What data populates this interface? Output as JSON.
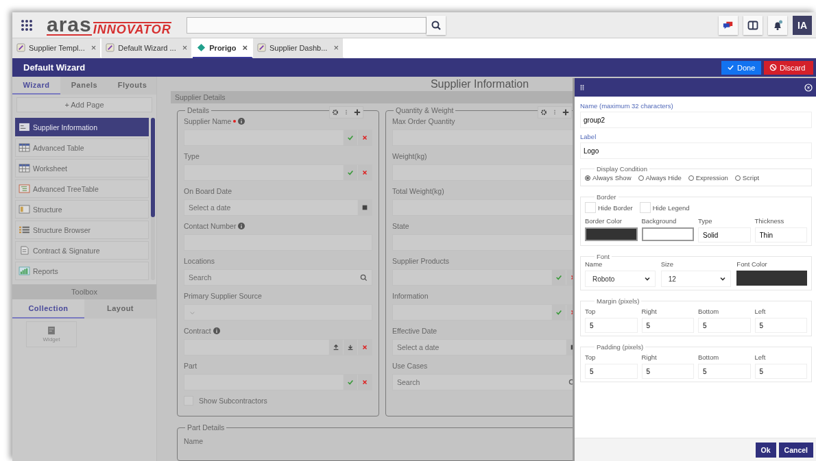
{
  "header": {
    "logo": {
      "word": "aras",
      "product": "INNOVATOR"
    },
    "avatar": "IA"
  },
  "tabs": [
    {
      "label": "Supplier Templ...",
      "kind": "pencil",
      "close": "×",
      "selected": false
    },
    {
      "label": "Default Wizard ...",
      "kind": "pencil",
      "close": "×",
      "selected": false
    },
    {
      "label": "Prorigo",
      "kind": "diamond",
      "close": "×",
      "selected": true
    },
    {
      "label": "Supplier Dashb...",
      "kind": "pencil",
      "close": "×",
      "selected": false
    }
  ],
  "title_bar": {
    "title": "Default Wizard",
    "done": "Done",
    "discard": "Discard"
  },
  "sidebar": {
    "tabs": [
      {
        "label": "Wizard",
        "selected": true
      },
      {
        "label": "Panels",
        "selected": false
      },
      {
        "label": "Flyouts",
        "selected": false
      }
    ],
    "add_page": "+ Add Page",
    "pages": [
      {
        "label": "Supplier Information",
        "kind": "form",
        "selected": true
      },
      {
        "label": "Advanced Table",
        "kind": "table",
        "selected": false
      },
      {
        "label": "Worksheet",
        "kind": "sheet",
        "selected": false
      },
      {
        "label": "Advanced TreeTable",
        "kind": "tree",
        "selected": false
      },
      {
        "label": "Structure",
        "kind": "structure",
        "selected": false
      },
      {
        "label": "Structure Browser",
        "kind": "list",
        "selected": false
      },
      {
        "label": "Contract & Signature",
        "kind": "document",
        "selected": false
      },
      {
        "label": "Reports",
        "kind": "chart",
        "selected": false
      }
    ],
    "toolbox": "Toolbox",
    "toolbox_tabs": [
      {
        "label": "Collection",
        "selected": true
      },
      {
        "label": "Layout",
        "selected": false
      }
    ],
    "widgets": [
      {
        "label": "Widget"
      }
    ]
  },
  "page": {
    "title": "Supplier Information",
    "section": "Supplier Details",
    "groups": [
      {
        "legend": "Details",
        "fields": [
          {
            "label": "Supplier Name",
            "kind": "validate",
            "required": true,
            "info": true
          },
          {
            "label": "Type",
            "kind": "validate",
            "required": false,
            "info": false
          },
          {
            "label": "On Board Date",
            "kind": "date",
            "placeholder": "Select a date",
            "required": false,
            "info": false
          },
          {
            "label": "Contact Number",
            "kind": "text",
            "required": false,
            "info": true
          },
          {
            "label": "Locations",
            "kind": "search",
            "placeholder": "Search",
            "required": false,
            "info": false
          },
          {
            "label": "Primary Supplier Source",
            "kind": "select",
            "required": false,
            "info": false
          },
          {
            "label": "Contract",
            "kind": "upload",
            "required": false,
            "info": true
          },
          {
            "label": "Part",
            "kind": "validate",
            "required": false,
            "info": false
          },
          {
            "label": "Show Subcontractors",
            "kind": "checkbox",
            "checked": false
          }
        ]
      },
      {
        "legend": "Quantity & Weight",
        "fields": [
          {
            "label": "Max Order Quantity",
            "kind": "text",
            "required": false,
            "info": false
          },
          {
            "label": "Weight(kg)",
            "kind": "text",
            "required": false,
            "info": false
          },
          {
            "label": "Total Weight(kg)",
            "kind": "text",
            "required": false,
            "info": false
          },
          {
            "label": "State",
            "kind": "text",
            "required": false,
            "info": false
          },
          {
            "label": "Supplier Products",
            "kind": "validate",
            "required": false,
            "info": false
          },
          {
            "label": "Information",
            "kind": "validate",
            "required": false,
            "info": false
          },
          {
            "label": "Effective Date",
            "kind": "date",
            "placeholder": "Select a date",
            "required": false,
            "info": false
          },
          {
            "label": "Use Cases",
            "kind": "search",
            "placeholder": "Search",
            "required": false,
            "info": false
          }
        ]
      }
    ],
    "lower_group": {
      "legend": "Part Details",
      "field_label": "Name"
    }
  },
  "dialog": {
    "name": {
      "label": "Name (maximum 32 characters)",
      "value": "group2"
    },
    "label": {
      "label": "Label",
      "value": "Logo"
    },
    "display_condition": {
      "legend": "Display Condition",
      "options": [
        {
          "label": "Always Show",
          "selected": true
        },
        {
          "label": "Always Hide",
          "selected": false
        },
        {
          "label": "Expression",
          "selected": false
        },
        {
          "label": "Script",
          "selected": false
        }
      ]
    },
    "border": {
      "legend": "Border",
      "checkboxes": [
        {
          "label": "Hide Border",
          "checked": false
        },
        {
          "label": "Hide Legend",
          "checked": false
        }
      ],
      "border_color": {
        "label": "Border Color",
        "color": "#333333"
      },
      "background": {
        "label": "Background",
        "color": "#ffffff"
      },
      "type": {
        "label": "Type",
        "value": "Solid"
      },
      "thickness": {
        "label": "Thickness",
        "value": "Thin"
      }
    },
    "font": {
      "legend": "Font",
      "name": {
        "label": "Name",
        "value": "Roboto"
      },
      "size": {
        "label": "Size",
        "value": "12"
      },
      "font_color": {
        "label": "Font Color",
        "color": "#333333"
      }
    },
    "margin": {
      "legend": "Margin (pixels)",
      "fields": [
        {
          "label": "Top",
          "value": "5"
        },
        {
          "label": "Right",
          "value": "5"
        },
        {
          "label": "Bottom",
          "value": "5"
        },
        {
          "label": "Left",
          "value": "5"
        }
      ]
    },
    "padding": {
      "legend": "Padding (pixels)",
      "fields": [
        {
          "label": "Top",
          "value": "5"
        },
        {
          "label": "Right",
          "value": "5"
        },
        {
          "label": "Bottom",
          "value": "5"
        },
        {
          "label": "Left",
          "value": "5"
        }
      ]
    },
    "buttons": [
      {
        "label": "Ok"
      },
      {
        "label": "Cancel"
      }
    ]
  }
}
